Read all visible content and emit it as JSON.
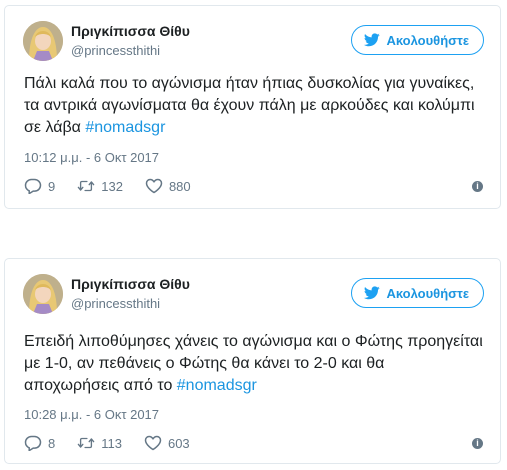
{
  "tweets": [
    {
      "name": "Πριγκίπισσα Θίθυ",
      "handle": "@princessthithi",
      "follow_label": "Ακολουθήστε",
      "text": "Πάλι καλά που το αγώνισμα ήταν ήπιας δυσκολίας για γυναίκες, τα αντρικά αγωνίσματα θα έχουν πάλη με αρκούδες και κολύμπι σε λάβα ",
      "hashtag": "#nomadsgr",
      "time": "10:12 μ.μ. - 6 Οκτ 2017",
      "replies": "9",
      "retweets": "132",
      "likes": "880"
    },
    {
      "name": "Πριγκίπισσα Θίθυ",
      "handle": "@princessthithi",
      "follow_label": "Ακολουθήστε",
      "text": "Επειδή λιποθύμησες χάνεις το αγώνισμα και ο Φώτης προηγείται με 1-0, αν πεθάνεις ο Φώτης θα κάνει το 2-0 και θα αποχωρήσεις από το ",
      "hashtag": "#nomadsgr",
      "time": "10:28 μ.μ. - 6 Οκτ 2017",
      "replies": "8",
      "retweets": "113",
      "likes": "603"
    }
  ],
  "icons": {
    "follow": "twitter-bird-icon",
    "reply": "reply-icon",
    "retweet": "retweet-icon",
    "like": "heart-icon",
    "info": "info-icon"
  },
  "colors": {
    "accent": "#1da1f2",
    "link": "#1b95e0",
    "secondary_text": "#657786",
    "border": "#e1e8ed"
  }
}
